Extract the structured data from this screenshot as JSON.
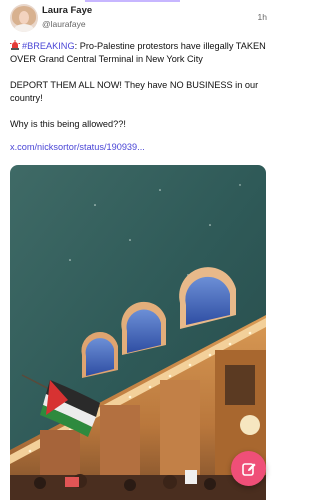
{
  "post": {
    "author_name": "Laura Faye",
    "author_handle": "@laurafaye",
    "timestamp": "1h",
    "hashtag": "#BREAKING",
    "headline_rest": ": Pro-Palestine protestors have illegally TAKEN OVER Grand Central Terminal in New York City",
    "paragraph2": "DEPORT THEM ALL NOW! They have NO BUSINESS in our country!",
    "paragraph3": "Why is this being allowed??!",
    "link_text": "x.com/nicksortor/status/190939..."
  },
  "icons": {
    "siren": "police-light-icon",
    "compose": "pencil-edit-icon"
  },
  "colors": {
    "hashtag": "#4a46d6",
    "fab": "#ef4f78"
  }
}
